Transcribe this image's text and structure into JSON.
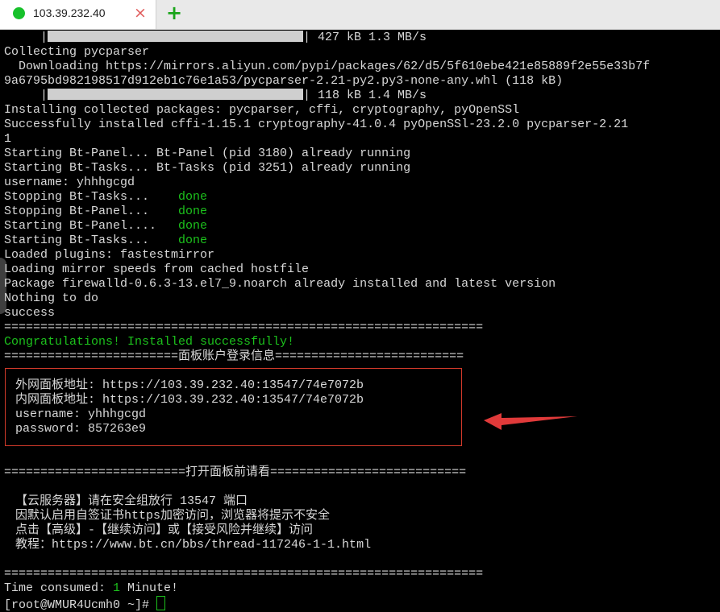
{
  "tab": {
    "title": "103.39.232.40",
    "close_icon": "×",
    "new_tab_icon": "+"
  },
  "colors": {
    "tab_dot": "#17c12b",
    "new_tab": "#1aa51a",
    "arrow": "#e03a3a"
  },
  "terminal": {
    "lines": [
      {
        "text": "     |",
        "bar": true,
        "bar_text": "| 427 kB 1.3 MB/s"
      },
      {
        "text": "Collecting pycparser"
      },
      {
        "text": "  Downloading https://mirrors.aliyun.com/pypi/packages/62/d5/5f610ebe421e85889f2e55e33b7f"
      },
      {
        "text": "9a6795bd982198517d912eb1c76e1a53/pycparser-2.21-py2.py3-none-any.whl (118 kB)"
      },
      {
        "text": "     |",
        "bar": true,
        "bar_text": "| 118 kB 1.4 MB/s"
      },
      {
        "text": "Installing collected packages: pycparser, cffi, cryptography, pyOpenSSl"
      },
      {
        "text": "Successfully installed cffi-1.15.1 cryptography-41.0.4 pyOpenSSl-23.2.0 pycparser-2.21"
      },
      {
        "text": "1"
      },
      {
        "text": "Starting Bt-Panel... Bt-Panel (pid 3180) already running"
      },
      {
        "text": "Starting Bt-Tasks... Bt-Tasks (pid 3251) already running"
      },
      {
        "text": "username: yhhhgcgd"
      },
      {
        "text": "Stopping Bt-Tasks...    ",
        "status": "done"
      },
      {
        "text": "Stopping Bt-Panel...    ",
        "status": "done"
      },
      {
        "text": "Starting Bt-Panel....   ",
        "status": "done"
      },
      {
        "text": "Starting Bt-Tasks...    ",
        "status": "done"
      },
      {
        "text": "Loaded plugins: fastestmirror"
      },
      {
        "text": "Loading mirror speeds from cached hostfile"
      },
      {
        "text": "Package firewalld-0.6.3-13.el7_9.noarch already installed and latest version"
      },
      {
        "text": "Nothing to do"
      },
      {
        "text": "success"
      },
      {
        "text": "=================================================================="
      },
      {
        "text": "Congratulations! Installed successfully!",
        "green": true
      },
      {
        "text": "========================面板账户登录信息=========================="
      },
      {
        "text": ""
      },
      {
        "text": " 外网面板地址: https://103.39.232.40:13547/74e7072b"
      },
      {
        "text": " 内网面板地址: https://103.39.232.40:13547/74e7072b"
      },
      {
        "text": " username: yhhhgcgd"
      },
      {
        "text": " password: 857263e9"
      },
      {
        "text": ""
      },
      {
        "text": ""
      },
      {
        "text": "=========================打开面板前请看==========================="
      },
      {
        "text": ""
      },
      {
        "text": " 【云服务器】请在安全组放行 13547 端口"
      },
      {
        "text": " 因默认启用自签证书https加密访问，浏览器将提示不安全"
      },
      {
        "text": " 点击【高级】-【继续访问】或【接受风险并继续】访问"
      },
      {
        "text": " 教程：https://www.bt.cn/bbs/thread-117246-1-1.html"
      },
      {
        "text": ""
      },
      {
        "text": "=================================================================="
      },
      {
        "text": "Time consumed: ",
        "green_suffix": "1",
        "suffix": " Minute!"
      },
      {
        "text": "[root@WMUR4Ucmh0 ~]# ",
        "cursor": true
      }
    ]
  }
}
